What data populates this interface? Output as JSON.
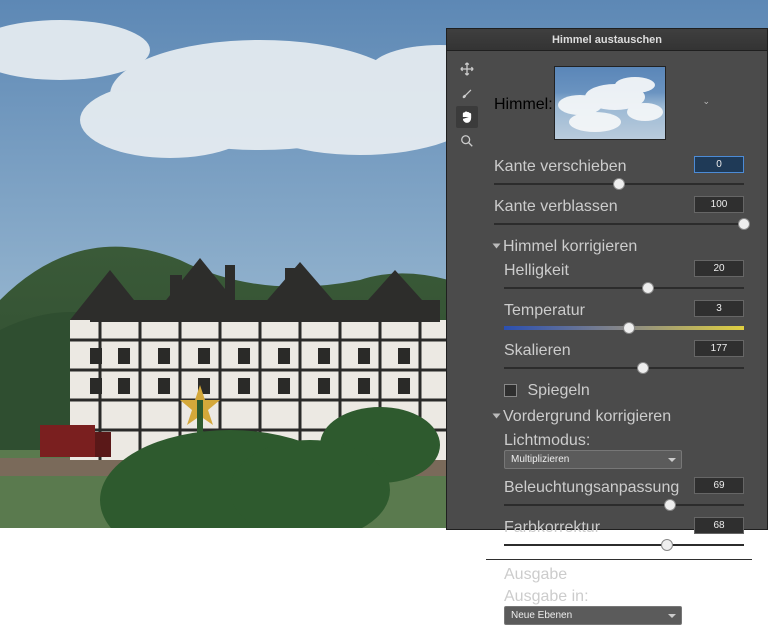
{
  "dialog": {
    "title": "Himmel austauschen",
    "sky_label": "Himmel:",
    "edge_shift_label": "Kante verschieben",
    "edge_shift_value": "0",
    "edge_fade_label": "Kante verblassen",
    "edge_fade_value": "100",
    "section_sky": "Himmel korrigieren",
    "brightness_label": "Helligkeit",
    "brightness_value": "20",
    "temperature_label": "Temperatur",
    "temperature_value": "3",
    "scale_label": "Skalieren",
    "scale_value": "177",
    "flip_label": "Spiegeln",
    "section_fg": "Vordergrund korrigieren",
    "light_mode_label": "Lichtmodus:",
    "light_mode_value": "Multiplizieren",
    "light_adjust_label": "Beleuchtungsanpassung",
    "light_adjust_value": "69",
    "color_adjust_label": "Farbkorrektur",
    "color_adjust_value": "68",
    "section_output": "Ausgabe",
    "output_label": "Ausgabe in:",
    "output_value": "Neue Ebenen"
  }
}
